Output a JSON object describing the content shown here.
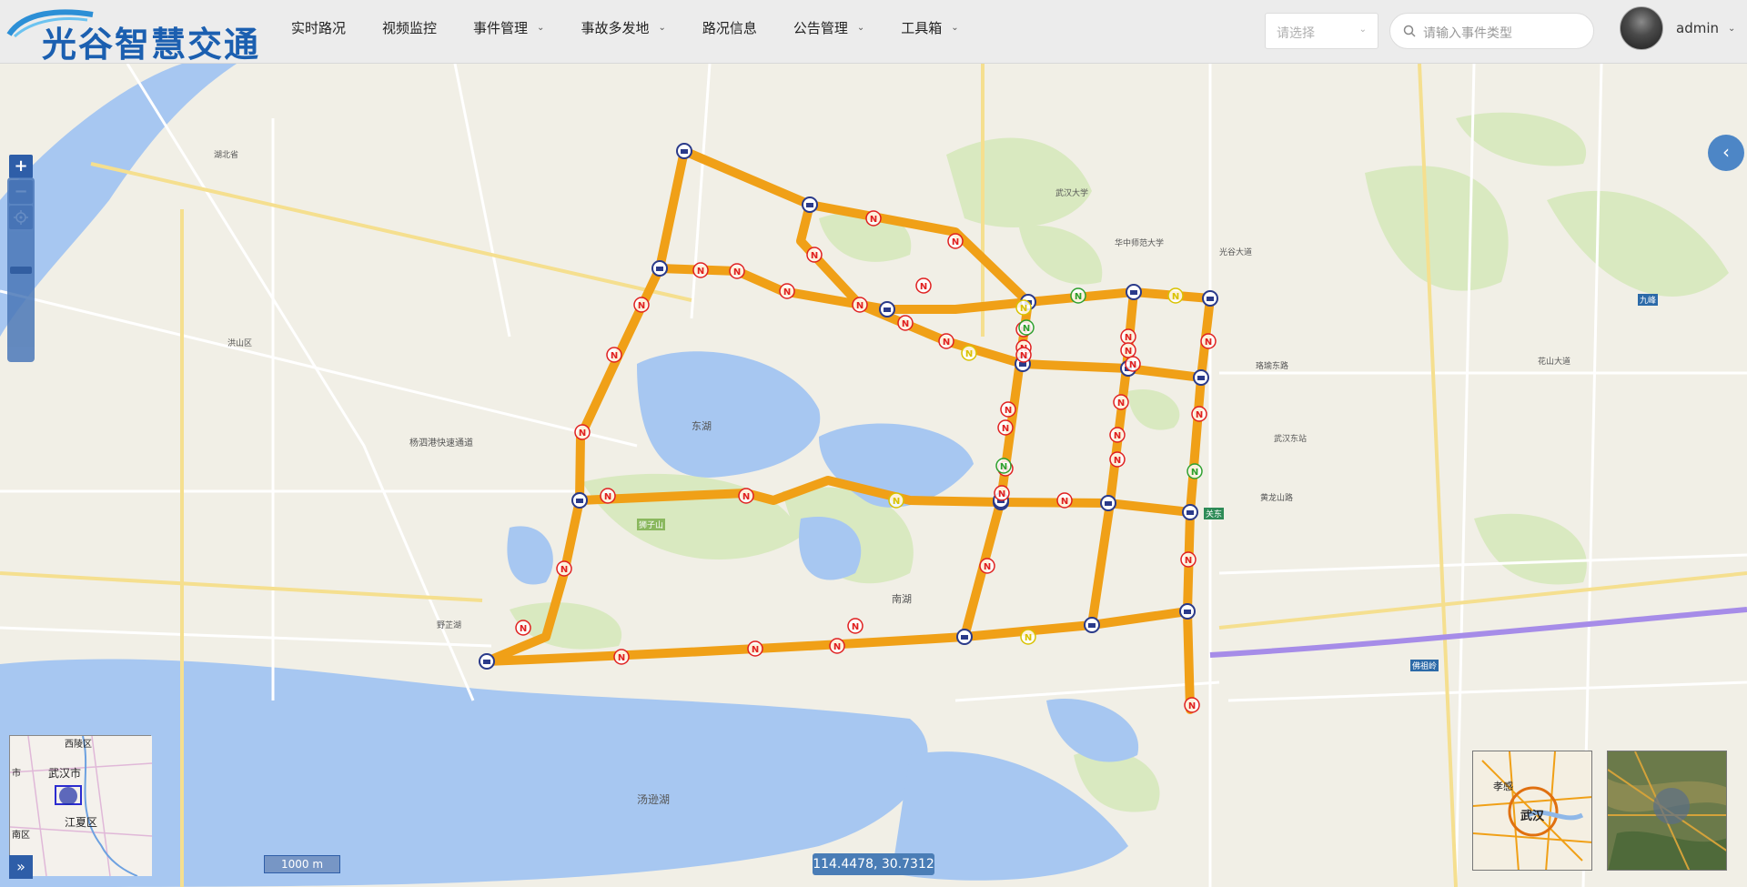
{
  "header": {
    "logo_text": "光谷智慧交通",
    "nav": [
      {
        "label": "实时路况",
        "has_menu": false
      },
      {
        "label": "视频监控",
        "has_menu": false
      },
      {
        "label": "事件管理",
        "has_menu": true
      },
      {
        "label": "事故多发地",
        "has_menu": true
      },
      {
        "label": "路况信息",
        "has_menu": false
      },
      {
        "label": "公告管理",
        "has_menu": true
      },
      {
        "label": "工具箱",
        "has_menu": true
      }
    ],
    "select_placeholder": "请选择",
    "search_placeholder": "请输入事件类型",
    "username": "admin"
  },
  "map": {
    "road_color": "#f5a40c",
    "lake_color": "#a9c8f0",
    "green_color": "#d5e8b8",
    "labels": {
      "l1": "湖北省",
      "l2": "武汉大学",
      "l3": "华中师范大学",
      "l4": "东湖",
      "l5": "南湖",
      "l6": "汤逊湖",
      "l7": "光谷大道",
      "l8": "杨泗港快速通道",
      "l9": "武汉东站",
      "l10": "珞瑜东路",
      "l11": "狮子山",
      "l12": "关东",
      "l13": "九峰",
      "l14": "佛祖岭",
      "l15": "洪山区",
      "l16": "野芷湖",
      "l17": "花山大道",
      "l18": "黄龙山路"
    },
    "markers": {
      "camera_count": 19,
      "incident_red_count": 40,
      "incident_yellow_count": 5,
      "incident_green_count": 4
    }
  },
  "controls": {
    "zoom_in": "+",
    "zoom_out": "−",
    "scale_label": "1000 m",
    "coordinates": "114.4478, 30.7312",
    "overview_toggle": "»",
    "overview_labels": {
      "o1": "市",
      "o2": "武汉市",
      "o3": "江夏区",
      "o4": "西陵区",
      "o5": "南区"
    },
    "layer_labels": {
      "a1": "孝感",
      "a2": "武汉"
    }
  }
}
